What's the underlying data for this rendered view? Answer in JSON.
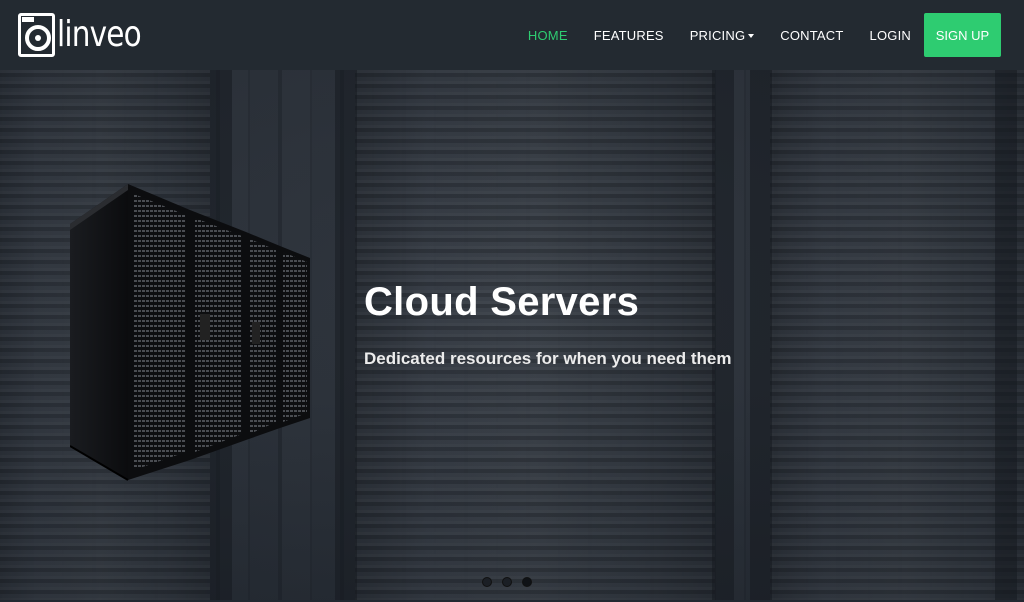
{
  "brand": {
    "name": "linveo"
  },
  "nav": {
    "items": [
      {
        "label": "HOME",
        "active": true
      },
      {
        "label": "FEATURES",
        "active": false
      },
      {
        "label": "PRICING",
        "active": false,
        "dropdown": true
      },
      {
        "label": "CONTACT",
        "active": false
      },
      {
        "label": "LOGIN",
        "active": false
      }
    ],
    "signup_label": "SIGN UP"
  },
  "hero": {
    "title": "Cloud Servers",
    "subtitle": "Dedicated resources for when you need them",
    "slides_total": 3,
    "active_slide": 3
  },
  "colors": {
    "accent": "#2ecc71",
    "navbar": "#232a31",
    "text": "#ffffff"
  }
}
